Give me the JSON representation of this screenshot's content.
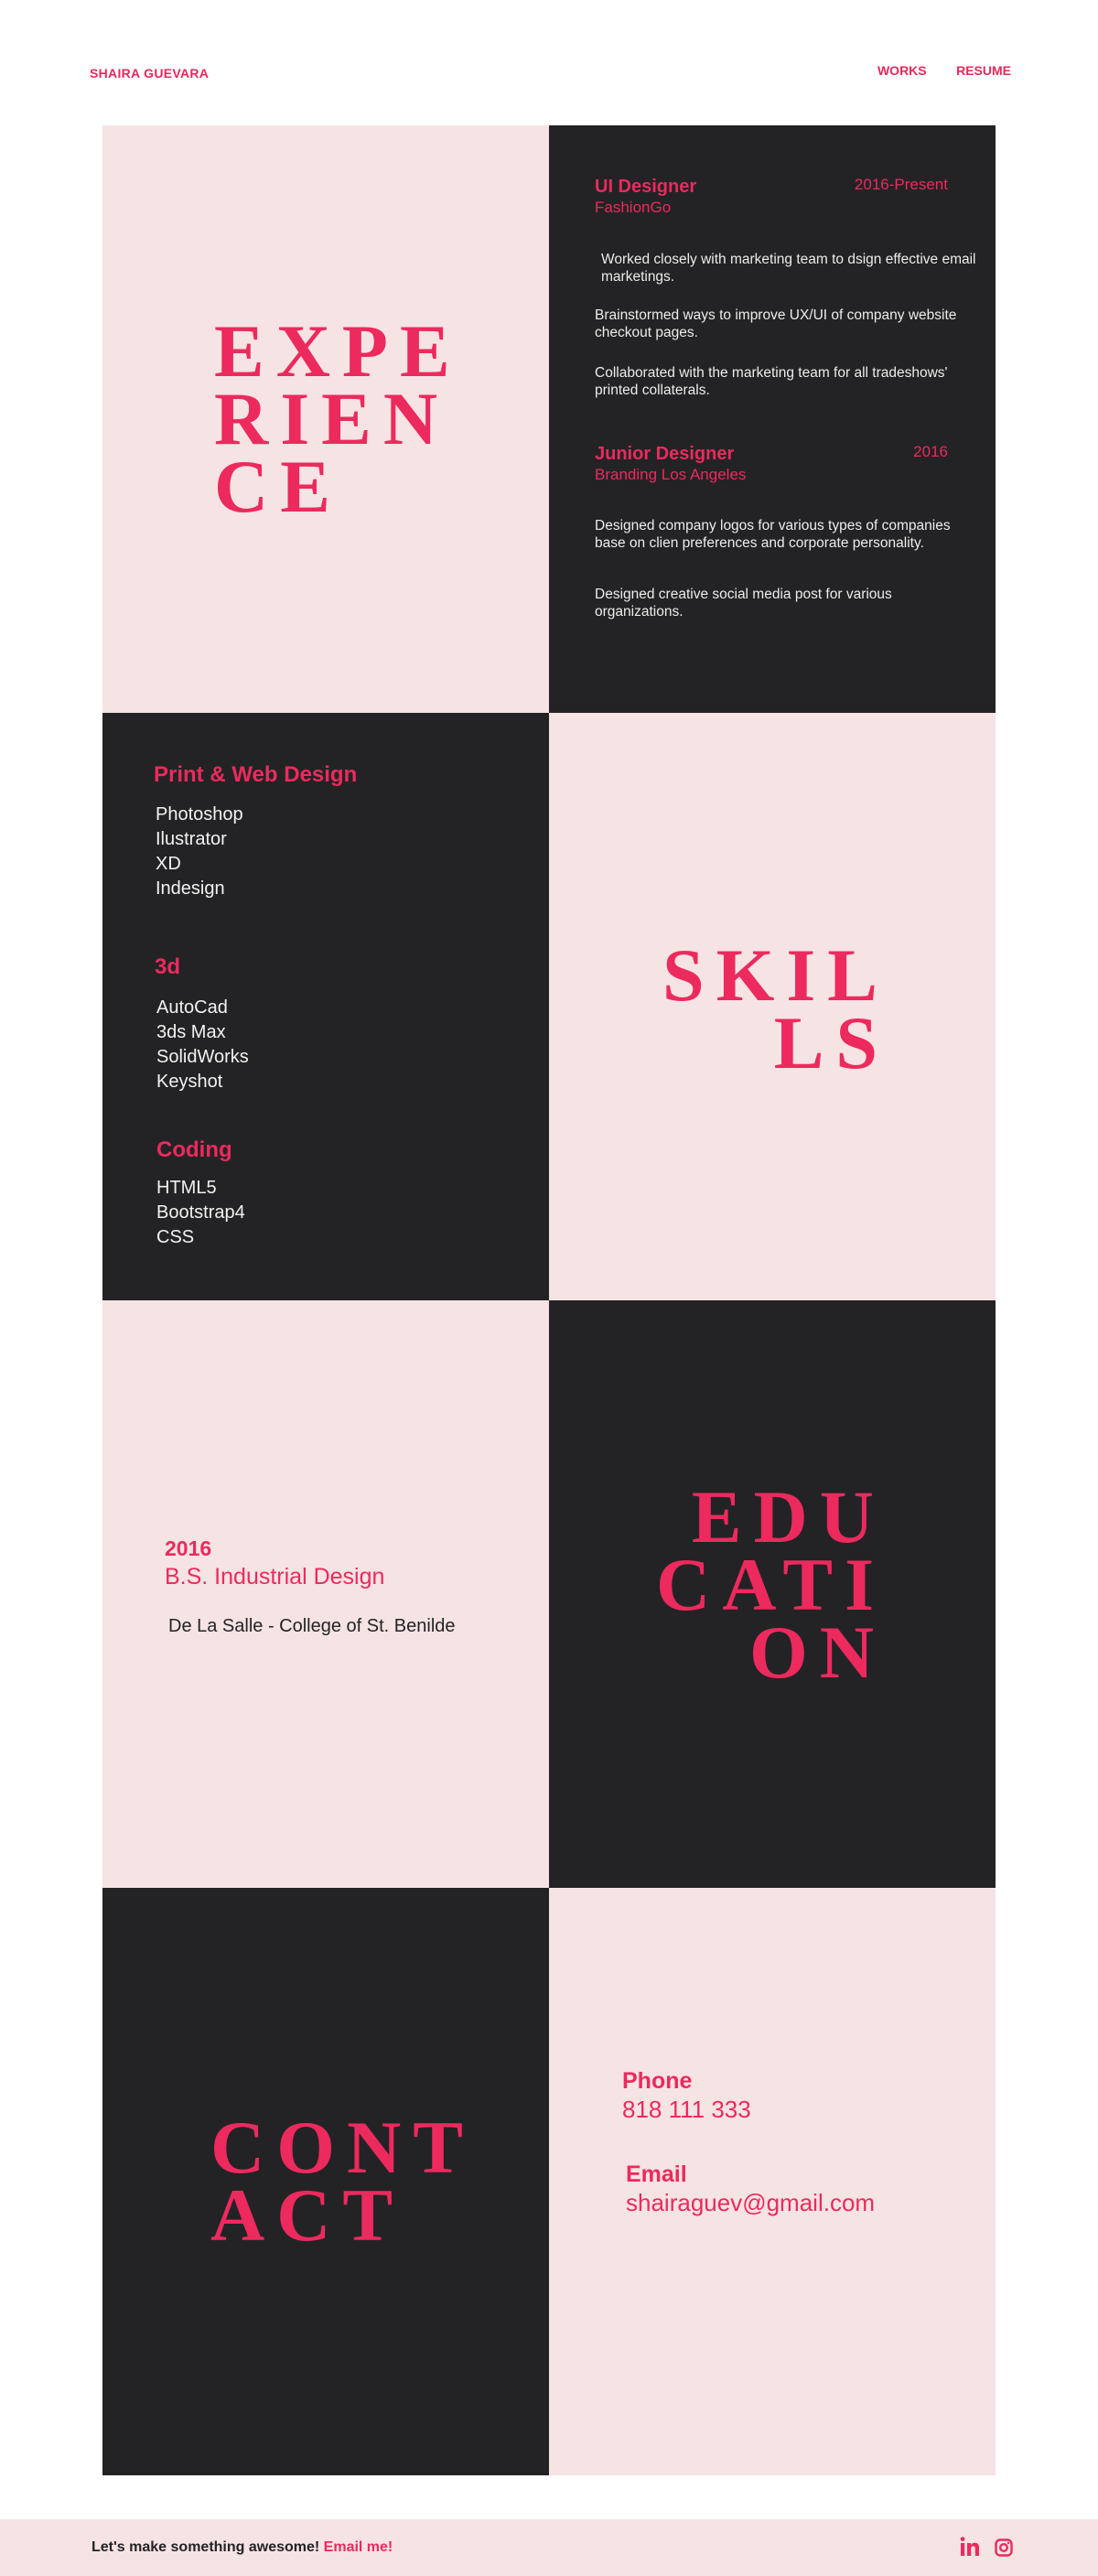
{
  "header": {
    "logo": "SHAIRA GUEVARA",
    "nav": [
      "WORKS",
      "RESUME"
    ]
  },
  "experience": {
    "heading_lines": [
      "EXPE",
      "RIEN",
      "CE"
    ],
    "jobs": [
      {
        "title": "UI Designer",
        "company": "FashionGo",
        "date": "2016-Present",
        "bullets": [
          "Worked closely with marketing team to dsign effective email marketings.",
          "Brainstormed ways to improve UX/UI of company website checkout pages.",
          "Collaborated with the marketing team for all tradeshows' printed collaterals."
        ]
      },
      {
        "title": "Junior Designer",
        "company": "Branding Los Angeles",
        "date": "2016",
        "bullets": [
          "Designed company logos for various types of companies base on clien preferences and corporate personality.",
          "Designed creative social media post for  various organizations."
        ]
      }
    ]
  },
  "skills": {
    "heading_lines": [
      "SKIL",
      "LS"
    ],
    "groups": [
      {
        "title": "Print & Web  Design",
        "items": [
          "Photoshop",
          "Ilustrator",
          "XD",
          "Indesign"
        ]
      },
      {
        "title": "3d",
        "items": [
          "AutoCad",
          "3ds Max",
          "SolidWorks",
          "Keyshot"
        ]
      },
      {
        "title": "Coding",
        "items": [
          "HTML5",
          "Bootstrap4",
          "CSS"
        ]
      }
    ]
  },
  "education": {
    "heading_lines": [
      "EDU",
      "CATI",
      "ON"
    ],
    "year": "2016",
    "degree": "B.S. Industrial Design",
    "school": "De La Salle - College of St. Benilde"
  },
  "contact": {
    "heading_lines": [
      "CONT",
      "ACT"
    ],
    "phone_label": "Phone",
    "phone": "818 111 333",
    "email_label": "Email",
    "email": "shairaguev@gmail.com"
  },
  "footer": {
    "text": "Let's make something awesome!",
    "link": "Email me!",
    "icons": [
      "linkedin-icon",
      "instagram-icon"
    ]
  },
  "colors": {
    "accent": "#ec2a5d",
    "dark": "#232325",
    "light_pink": "#f6e3e4"
  }
}
